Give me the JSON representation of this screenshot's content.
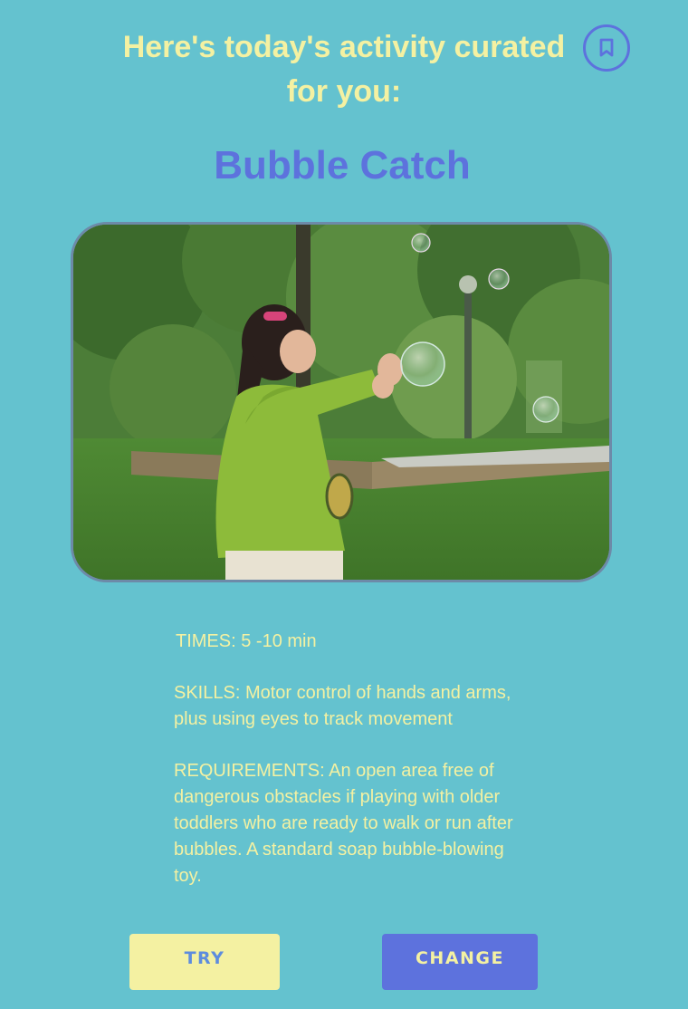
{
  "header": {
    "title": "Here's today's activity curated for you:"
  },
  "activity": {
    "name": "Bubble Catch",
    "image_icon": "photo-girl-catching-bubbles"
  },
  "details": {
    "times_label": "TIMES:",
    "times_value": "5 -10 min",
    "skills_label": "SKILLS:",
    "skills_value": "Motor control of hands and arms, plus using eyes to track movement",
    "requirements_label": "REQUIREMENTS:",
    "requirements_value": "An open area free of dangerous obstacles if playing with older toddlers who are ready to walk or run after bubbles. A standard soap bubble-blowing toy."
  },
  "actions": {
    "try_label": "TRY",
    "change_label": "CHANGE"
  },
  "icons": {
    "bookmark": "bookmark-icon"
  },
  "colors": {
    "background": "#64c2cf",
    "accent_yellow": "#f4f1a2",
    "accent_blue": "#5d72dd"
  }
}
